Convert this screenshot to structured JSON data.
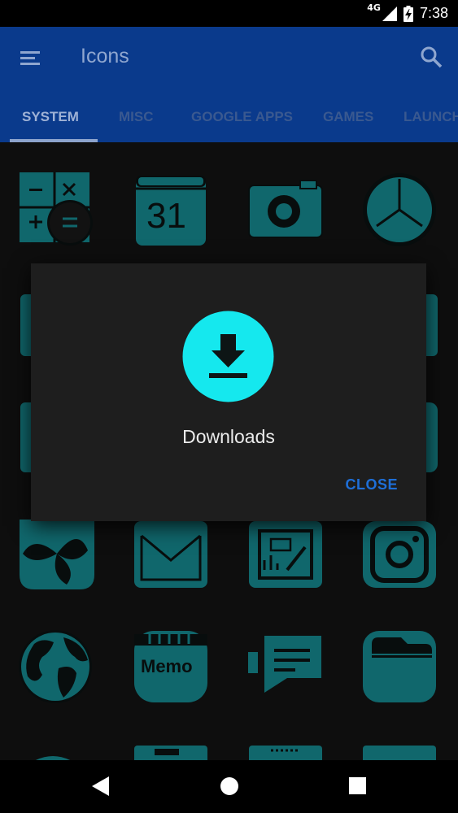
{
  "status_bar": {
    "network": "4G",
    "time": "7:38",
    "icons": [
      "signal-icon",
      "battery-charging-icon"
    ]
  },
  "app_bar": {
    "title": "Icons",
    "menu_icon": "hamburger-menu-icon",
    "search_icon": "search-icon"
  },
  "tabs": [
    {
      "label": "SYSTEM",
      "active": true
    },
    {
      "label": "MISC",
      "active": false
    },
    {
      "label": "GOOGLE APPS",
      "active": false
    },
    {
      "label": "GAMES",
      "active": false
    },
    {
      "label": "LAUNCH",
      "active": false
    }
  ],
  "grid": {
    "icons": [
      "calculator-icon",
      "calendar-icon",
      "camera-icon",
      "clock-icon",
      "file-icon",
      "folder-icon",
      "contacts-icon",
      "messages-icon",
      "photos-icon",
      "mail-icon",
      "sketch-app-icon",
      "instagram-icon",
      "browser-globe-icon",
      "memo-icon",
      "chat-icon",
      "files-icon"
    ],
    "calendar_day": "31",
    "memo_label": "Memo"
  },
  "dialog": {
    "icon": "download-icon",
    "title": "Downloads",
    "close_label": "CLOSE"
  },
  "nav_bar": {
    "icons": [
      "back-icon",
      "home-icon",
      "recents-icon"
    ]
  },
  "colors": {
    "app_bar": "#0a3a8c",
    "icon_teal": "#1a9fa6",
    "accent_cyan": "#15e8ee",
    "close_blue": "#1e6fd8",
    "dialog_bg": "#1e1e1e",
    "content_bg": "#161616"
  }
}
